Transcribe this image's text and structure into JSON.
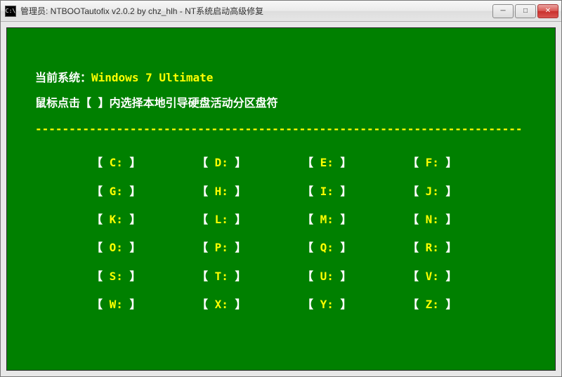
{
  "window": {
    "icon_label": "C:\\",
    "title": "管理员:  NTBOOTautofix v2.0.2 by chz_hlh - NT系统启动高级修复"
  },
  "controls": {
    "minimize_glyph": "─",
    "maximize_glyph": "□",
    "close_glyph": "✕"
  },
  "console": {
    "current_system_label": "当前系统：",
    "current_system_value": "Windows 7 Ultimate",
    "instruction": "鼠标点击【 】内选择本地引导硬盘活动分区盘符",
    "separator": "------------------------------------------------------------------------",
    "bracket_left": "【",
    "bracket_right": "】",
    "drives": [
      [
        "C:",
        "D:",
        "E:",
        "F:"
      ],
      [
        "G:",
        "H:",
        "I:",
        "J:"
      ],
      [
        "K:",
        "L:",
        "M:",
        "N:"
      ],
      [
        "O:",
        "P:",
        "Q:",
        "R:"
      ],
      [
        "S:",
        "T:",
        "U:",
        "V:"
      ],
      [
        "W:",
        "X:",
        "Y:",
        "Z:"
      ]
    ]
  }
}
